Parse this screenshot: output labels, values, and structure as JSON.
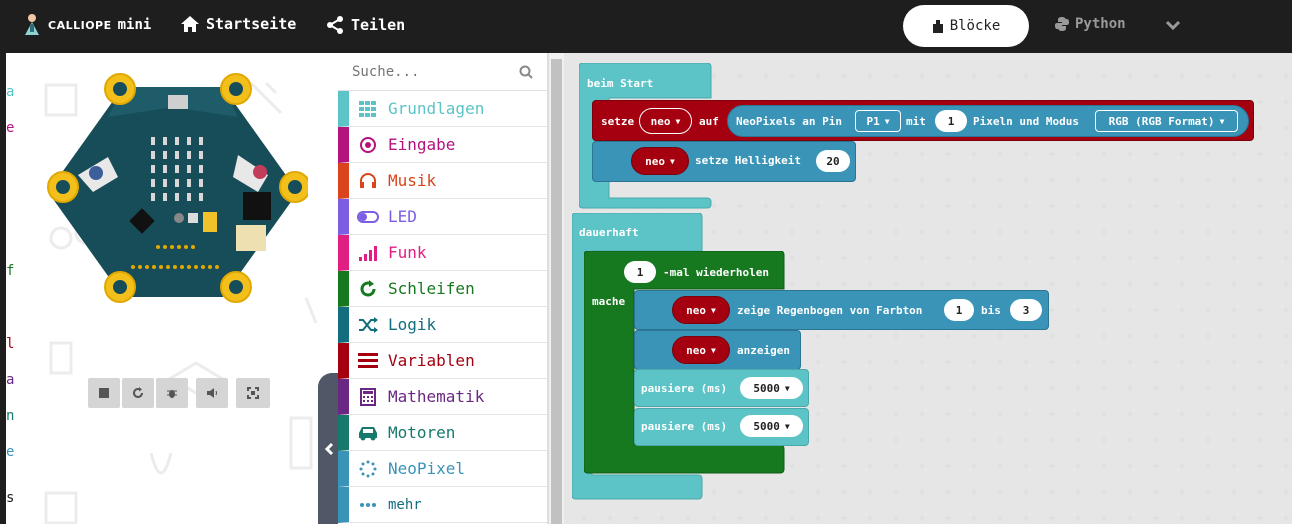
{
  "header": {
    "logo_brand": "CALLIOPE",
    "logo_product": "mini",
    "nav_home": "Startseite",
    "nav_share": "Teilen",
    "mode_blocks": "Blöcke",
    "mode_python": "Python"
  },
  "edge_text": [
    "a",
    "e",
    "f",
    "l",
    "a",
    "n",
    "e",
    "s"
  ],
  "toolbox": {
    "search_placeholder": "Suche...",
    "categories": [
      {
        "label": "Grundlagen",
        "color": "#5cc4c6",
        "icon": "grid-icon"
      },
      {
        "label": "Eingabe",
        "color": "#b4127c",
        "icon": "target-icon"
      },
      {
        "label": "Musik",
        "color": "#d9441c",
        "icon": "headphones-icon"
      },
      {
        "label": "LED",
        "color": "#7d5de4",
        "icon": "toggle-icon"
      },
      {
        "label": "Funk",
        "color": "#e11f83",
        "icon": "signal-bars-icon"
      },
      {
        "label": "Schleifen",
        "color": "#17791f",
        "icon": "loop-arrow-icon"
      },
      {
        "label": "Logik",
        "color": "#126e7e",
        "icon": "shuffle-icon"
      },
      {
        "label": "Variablen",
        "color": "#a4000f",
        "icon": "list-lines-icon"
      },
      {
        "label": "Mathematik",
        "color": "#6a2783",
        "icon": "calculator-icon"
      },
      {
        "label": "Motoren",
        "color": "#16796c",
        "icon": "car-icon"
      },
      {
        "label": "NeoPixel",
        "color": "#3994b8",
        "icon": "dotted-ring-icon"
      }
    ],
    "more_label": "mehr"
  },
  "blocks": {
    "on_start": {
      "label": "beim Start",
      "set_label": "setze",
      "var_name": "neo",
      "to_label": "auf",
      "neopixel_label": "NeoPixels an Pin",
      "pin": "P1",
      "with_label": "mit",
      "count": "1",
      "pixels_mode_label": "Pixeln und Modus",
      "mode": "RGB (RGB Format)",
      "brightness_var": "neo",
      "brightness_label": "setze Helligkeit",
      "brightness_value": "20"
    },
    "forever": {
      "label": "dauerhaft",
      "repeat_count": "1",
      "repeat_label": "-mal wiederholen",
      "do_label": "mache",
      "rainbow_var": "neo",
      "rainbow_label": "zeige Regenbogen von Farbton",
      "rainbow_from": "1",
      "rainbow_to_label": "bis",
      "rainbow_to": "3",
      "show_var": "neo",
      "show_label": "anzeigen",
      "pause1_label": "pausiere (ms)",
      "pause1_value": "5000",
      "pause2_label": "pausiere (ms)",
      "pause2_value": "5000"
    }
  },
  "colors": {
    "topbar": "#1e1e1e",
    "basic_block": "#5cc4c6",
    "neopixel_block": "#3994b8",
    "variable_block": "#a4000f",
    "loop_block": "#17791f"
  }
}
